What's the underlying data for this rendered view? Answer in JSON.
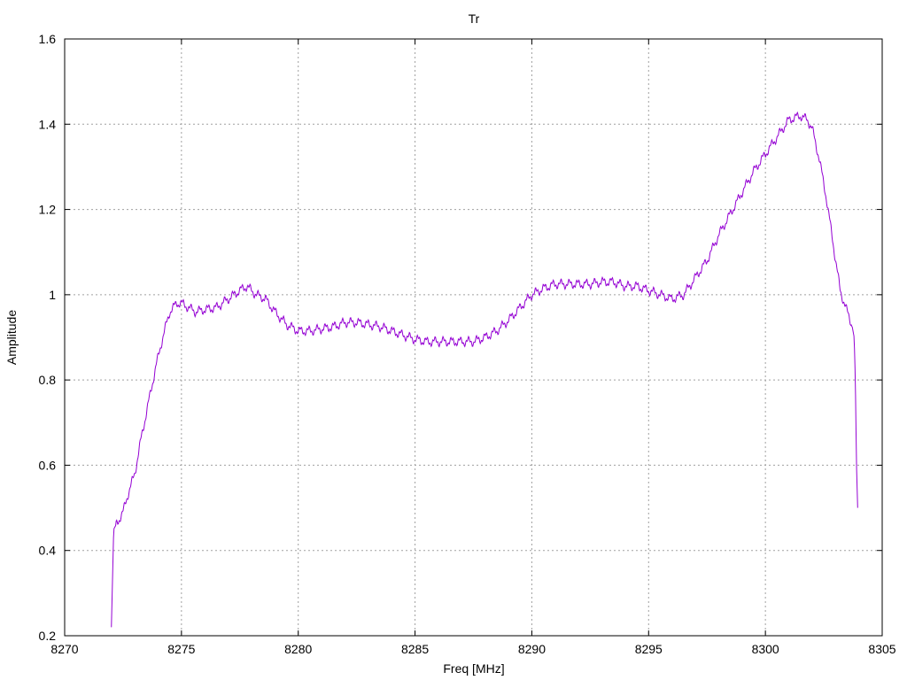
{
  "chart_data": {
    "type": "line",
    "title": "Tr",
    "xlabel": "Freq [MHz]",
    "ylabel": "Amplitude",
    "xlim": [
      8270,
      8305
    ],
    "ylim": [
      0.2,
      1.6
    ],
    "xticks": [
      8270,
      8275,
      8280,
      8285,
      8290,
      8295,
      8300,
      8305
    ],
    "xtick_labels": [
      "8270",
      "8275",
      "8280",
      "8285",
      "8290",
      "8295",
      "8300",
      "8305"
    ],
    "yticks": [
      0.2,
      0.4,
      0.6,
      0.8,
      1.0,
      1.2,
      1.4,
      1.6
    ],
    "ytick_labels": [
      "0.2",
      "0.4",
      "0.6",
      "0.8",
      "1",
      "1.2",
      "1.4",
      "1.6"
    ],
    "grid": true,
    "legend": "none",
    "line_color": "#9400d3",
    "series": [
      {
        "x": [
          8272.0,
          8272.1,
          8272.3,
          8272.5,
          8272.7,
          8273.0,
          8273.3,
          8273.6,
          8273.9,
          8274.2,
          8274.5,
          8274.8,
          8275.0,
          8275.3,
          8275.6,
          8276.0,
          8276.5,
          8277.0,
          8277.5,
          8277.8,
          8278.2,
          8278.6,
          8279.0,
          8279.5,
          8280.0,
          8280.5,
          8281.0,
          8281.5,
          8282.0,
          8282.5,
          8283.0,
          8283.5,
          8284.0,
          8284.5,
          8285.0,
          8285.5,
          8286.0,
          8286.5,
          8287.0,
          8287.5,
          8288.0,
          8288.5,
          8289.0,
          8289.5,
          8290.0,
          8290.5,
          8291.0,
          8291.5,
          8292.0,
          8292.5,
          8293.0,
          8293.5,
          8294.0,
          8294.5,
          8295.0,
          8295.5,
          8296.0,
          8296.5,
          8297.0,
          8297.5,
          8298.0,
          8298.5,
          8299.0,
          8299.5,
          8300.0,
          8300.5,
          8301.0,
          8301.5,
          8301.8,
          8302.0,
          8302.3,
          8302.6,
          8302.9,
          8303.2,
          8303.5,
          8303.7,
          8303.8,
          8303.85,
          8303.9,
          8303.95
        ],
        "y": [
          0.22,
          0.45,
          0.47,
          0.49,
          0.53,
          0.58,
          0.67,
          0.75,
          0.83,
          0.9,
          0.96,
          0.98,
          0.98,
          0.97,
          0.96,
          0.965,
          0.97,
          0.99,
          1.01,
          1.02,
          1.0,
          0.99,
          0.96,
          0.93,
          0.915,
          0.915,
          0.92,
          0.925,
          0.935,
          0.935,
          0.93,
          0.925,
          0.915,
          0.905,
          0.895,
          0.89,
          0.89,
          0.89,
          0.89,
          0.89,
          0.9,
          0.915,
          0.94,
          0.97,
          1.0,
          1.015,
          1.025,
          1.025,
          1.025,
          1.025,
          1.03,
          1.03,
          1.02,
          1.02,
          1.01,
          1.0,
          0.99,
          1.0,
          1.04,
          1.08,
          1.14,
          1.19,
          1.24,
          1.29,
          1.33,
          1.37,
          1.41,
          1.42,
          1.41,
          1.39,
          1.32,
          1.23,
          1.12,
          1.01,
          0.96,
          0.93,
          0.9,
          0.8,
          0.6,
          0.5
        ]
      }
    ]
  }
}
